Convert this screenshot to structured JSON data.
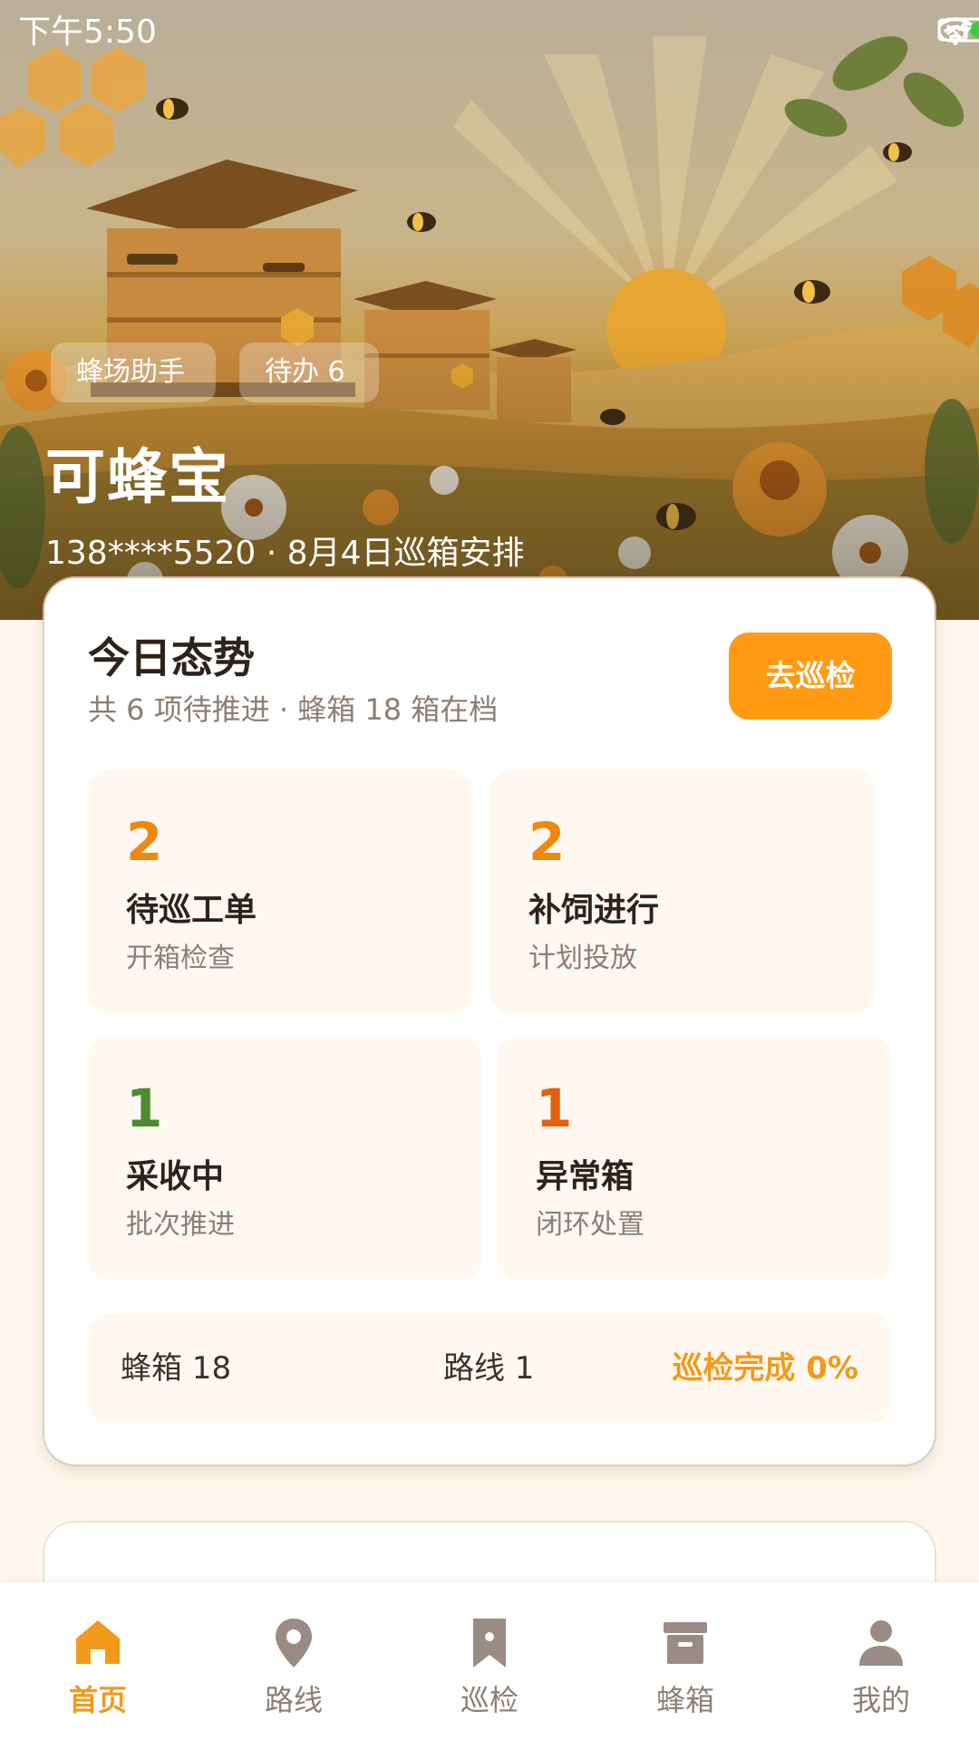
{
  "status_bar": {
    "time": "下午5:50",
    "icons": [
      "sim-error-icon",
      "wifi-icon",
      "battery-charging-icon"
    ]
  },
  "hero": {
    "chips": [
      "蜂场助手",
      "待办 6"
    ],
    "title": "可蜂宝",
    "subtitle": "138****5520 · 8月4日巡箱安排"
  },
  "overview": {
    "title": "今日态势",
    "subtitle": "共 6 项待推进 · 蜂箱 18 箱在档",
    "action_label": "去巡检",
    "stats": [
      {
        "value": "2",
        "label": "待巡工单",
        "desc": "开箱检查",
        "color": "#F0870F"
      },
      {
        "value": "2",
        "label": "补饲进行",
        "desc": "计划投放",
        "color": "#F0870F"
      },
      {
        "value": "1",
        "label": "采收中",
        "desc": "批次推进",
        "color": "#4E8A2F"
      },
      {
        "value": "1",
        "label": "异常箱",
        "desc": "闭环处置",
        "color": "#E0610E"
      }
    ],
    "summary": {
      "hives": "蜂箱 18",
      "routes": "路线 1",
      "progress": "巡检完成 0%"
    }
  },
  "nav": {
    "items": [
      {
        "label": "首页",
        "icon": "home-icon",
        "active": true
      },
      {
        "label": "路线",
        "icon": "location-pin-icon",
        "active": false
      },
      {
        "label": "巡检",
        "icon": "bookmark-icon",
        "active": false
      },
      {
        "label": "蜂箱",
        "icon": "archive-box-icon",
        "active": false
      },
      {
        "label": "我的",
        "icon": "person-icon",
        "active": false
      }
    ],
    "active_color": "#F29A1B",
    "inactive_color": "#8C7E74"
  }
}
